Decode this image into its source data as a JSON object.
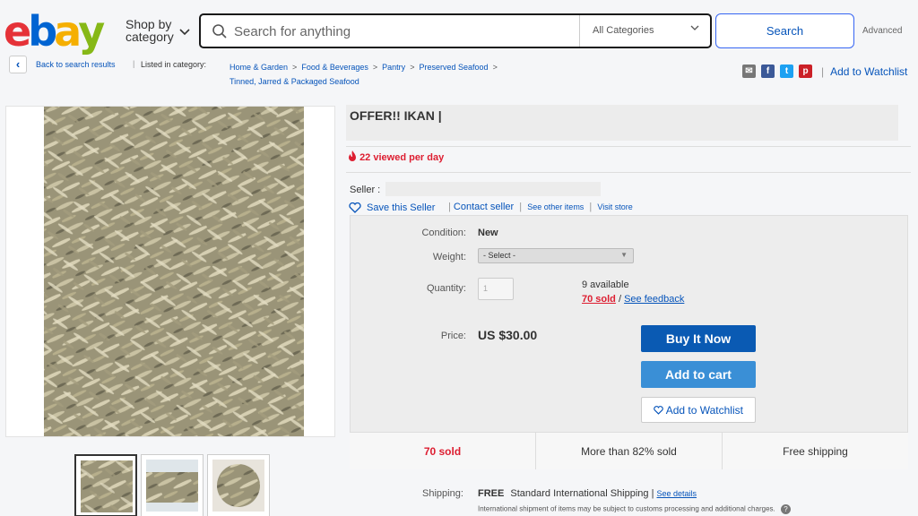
{
  "header": {
    "logo_letters": [
      "e",
      "b",
      "a",
      "y"
    ],
    "logo_colors": [
      "#e53238",
      "#0064d2",
      "#f5af02",
      "#86b817"
    ],
    "shop_by_line1": "Shop by",
    "shop_by_line2": "category",
    "search_placeholder": "Search for anything",
    "category_select": "All Categories",
    "search_button": "Search",
    "advanced_link": "Advanced"
  },
  "breadcrumb": {
    "back_link": "Back to search results",
    "listed_in": "Listed in category:",
    "crumbs": [
      "Home & Garden",
      "Food & Beverages",
      "Pantry",
      "Preserved Seafood",
      "Tinned, Jarred & Packaged Seafood"
    ],
    "share_icons": [
      "email-icon",
      "facebook-icon",
      "twitter-icon",
      "pinterest-icon"
    ],
    "add_to_watchlist": "Add to Watchlist"
  },
  "listing": {
    "title": "OFFER!! IKAN |",
    "viewed_per_day": "22 viewed per day",
    "seller_label": "Seller :",
    "save_seller": "Save this Seller",
    "contact_seller": "Contact seller",
    "see_other_items": "See other items",
    "visit_store": "Visit store"
  },
  "buy_box": {
    "condition_label": "Condition:",
    "condition_value": "New",
    "weight_label": "Weight:",
    "weight_select": "- Select -",
    "quantity_label": "Quantity:",
    "quantity_value": "1",
    "available": "9 available",
    "sold_link": "70 sold",
    "feedback_link": "See feedback",
    "price_label": "Price:",
    "price_value": "US $30.00",
    "buy_it_now": "Buy It Now",
    "add_to_cart": "Add to cart",
    "add_to_watchlist": "Add to Watchlist"
  },
  "stats": {
    "sold": "70 sold",
    "percent_sold": "More than 82% sold",
    "shipping": "Free shipping"
  },
  "shipping": {
    "label": "Shipping:",
    "free": "FREE",
    "method": "Standard International Shipping",
    "see_details": "See details",
    "note": "International shipment of items may be subject to customs processing and additional charges."
  },
  "colors": {
    "accent_blue": "#0654ba",
    "buy_button": "#0a5ab3",
    "cart_button": "#3a8fd6",
    "alert_red": "#dd1e31"
  }
}
